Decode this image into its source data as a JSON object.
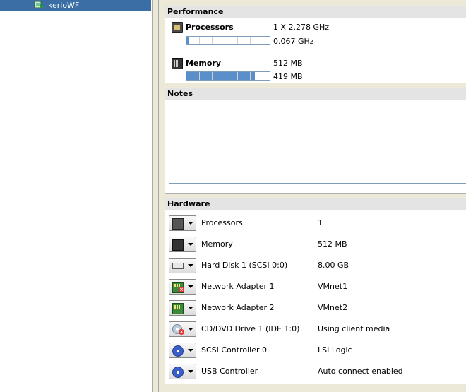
{
  "tree": {
    "selected_vm": "kerioWF"
  },
  "performance": {
    "title": "Performance",
    "processors": {
      "label": "Processors",
      "spec": "1 X 2.278 GHz",
      "usage": "0.067 GHz",
      "usage_fraction": 0.03
    },
    "memory": {
      "label": "Memory",
      "spec": "512 MB",
      "usage": "419 MB",
      "usage_fraction": 0.82
    }
  },
  "notes": {
    "title": "Notes",
    "text": ""
  },
  "hardware": {
    "title": "Hardware",
    "items": [
      {
        "name": "Processors",
        "value": "1",
        "icon": "processor-icon",
        "status": "ok"
      },
      {
        "name": "Memory",
        "value": "512 MB",
        "icon": "memory-icon",
        "status": "ok"
      },
      {
        "name": "Hard Disk 1 (SCSI 0:0)",
        "value": "8.00 GB",
        "icon": "hard-disk-icon",
        "status": "ok"
      },
      {
        "name": "Network Adapter 1",
        "value": "VMnet1",
        "icon": "network-adapter-icon",
        "status": "disconnected"
      },
      {
        "name": "Network Adapter 2",
        "value": "VMnet2",
        "icon": "network-adapter-icon",
        "status": "ok"
      },
      {
        "name": "CD/DVD Drive 1 (IDE 1:0)",
        "value": "Using client media",
        "icon": "cd-dvd-icon",
        "status": "disconnected"
      },
      {
        "name": "SCSI Controller 0",
        "value": "LSI Logic",
        "icon": "scsi-controller-icon",
        "status": "ok"
      },
      {
        "name": "USB Controller",
        "value": "Auto connect enabled",
        "icon": "usb-controller-icon",
        "status": "ok"
      }
    ]
  },
  "colors": {
    "selection": "#3a6ea5",
    "bar_fill": "#5b8fc9",
    "panel_bg": "#ece9d8"
  }
}
